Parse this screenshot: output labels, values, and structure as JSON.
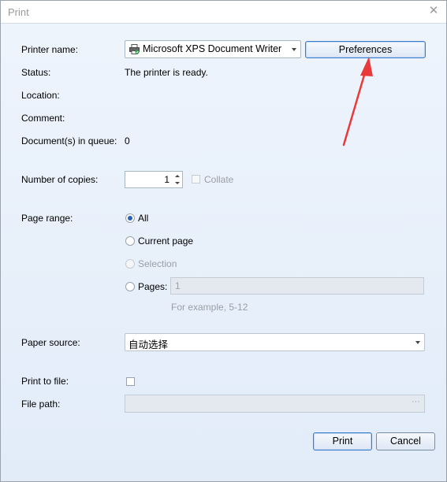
{
  "window": {
    "title": "Print",
    "close_glyph": "✕"
  },
  "labels": {
    "printer_name": "Printer name:",
    "status": "Status:",
    "location": "Location:",
    "comment": "Comment:",
    "queue": "Document(s) in queue:",
    "copies": "Number of copies:",
    "page_range": "Page range:",
    "paper_source": "Paper source:",
    "print_to_file": "Print to file:",
    "file_path": "File path:"
  },
  "values": {
    "printer": "Microsoft XPS Document Writer",
    "status": "The printer is ready.",
    "location": "",
    "comment": "",
    "queue": "0",
    "copies": "1",
    "paper_source": "自动选择",
    "pages_value": "1",
    "pages_hint": "For example, 5-12",
    "file_path": "",
    "file_path_browse": "···"
  },
  "options": {
    "collate": "Collate",
    "all": "All",
    "current_page": "Current page",
    "selection": "Selection",
    "pages": "Pages:"
  },
  "buttons": {
    "preferences": "Preferences",
    "print": "Print",
    "cancel": "Cancel"
  },
  "icons": {
    "printer": "printer-icon",
    "close": "close-icon",
    "arrow": "red-arrow-annotation"
  },
  "colors": {
    "accent": "#2a63b5",
    "annotation": "#e83a3a"
  }
}
